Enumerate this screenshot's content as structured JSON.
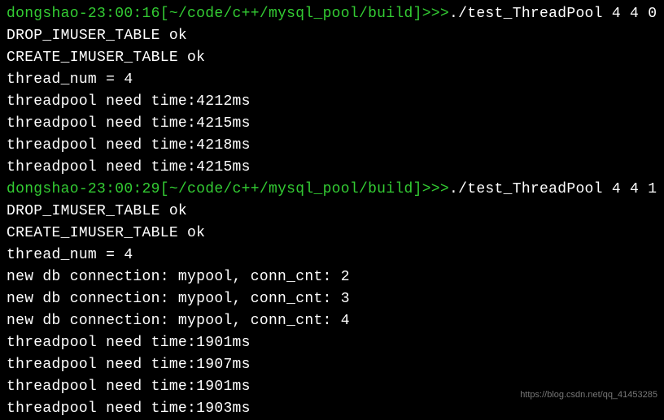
{
  "lines": [
    {
      "type": "prompt",
      "user": "dongshao",
      "time": "23:00:16",
      "path": "~/code/c++/mysql_pool/build",
      "arrows": ">>>",
      "command": "./test_ThreadPool 4 4 0"
    },
    {
      "type": "output",
      "text": "DROP_IMUSER_TABLE ok"
    },
    {
      "type": "output",
      "text": "CREATE_IMUSER_TABLE ok"
    },
    {
      "type": "output",
      "text": "thread_num = 4"
    },
    {
      "type": "output",
      "text": "threadpool need time:4212ms"
    },
    {
      "type": "output",
      "text": "threadpool need time:4215ms"
    },
    {
      "type": "output",
      "text": "threadpool need time:4218ms"
    },
    {
      "type": "output",
      "text": "threadpool need time:4215ms"
    },
    {
      "type": "prompt",
      "user": "dongshao",
      "time": "23:00:29",
      "path": "~/code/c++/mysql_pool/build",
      "arrows": ">>>",
      "command": "./test_ThreadPool 4 4 1"
    },
    {
      "type": "output",
      "text": "DROP_IMUSER_TABLE ok"
    },
    {
      "type": "output",
      "text": "CREATE_IMUSER_TABLE ok"
    },
    {
      "type": "output",
      "text": "thread_num = 4"
    },
    {
      "type": "output",
      "text": "new db connection: mypool, conn_cnt: 2"
    },
    {
      "type": "output",
      "text": "new db connection: mypool, conn_cnt: 3"
    },
    {
      "type": "output",
      "text": "new db connection: mypool, conn_cnt: 4"
    },
    {
      "type": "output",
      "text": "threadpool need time:1901ms"
    },
    {
      "type": "output",
      "text": "threadpool need time:1907ms"
    },
    {
      "type": "output",
      "text": "threadpool need time:1901ms"
    },
    {
      "type": "output",
      "text": "threadpool need time:1903ms"
    }
  ],
  "watermark": "https://blog.csdn.net/qq_41453285"
}
